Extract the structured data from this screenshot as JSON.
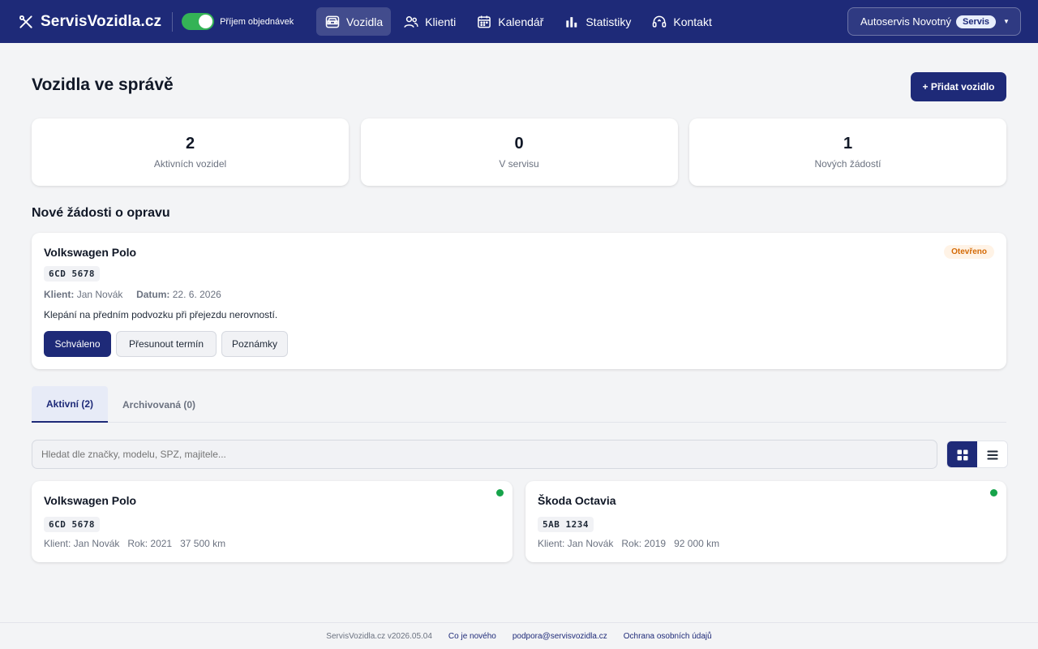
{
  "header": {
    "brand": "ServisVozidla.cz",
    "toggle_label": "Příjem objednávek",
    "toggle_on": true,
    "nav": [
      {
        "label": "Vozidla",
        "icon": "car-icon",
        "active": true
      },
      {
        "label": "Klienti",
        "icon": "users-icon",
        "active": false
      },
      {
        "label": "Kalendář",
        "icon": "calendar-icon",
        "active": false
      },
      {
        "label": "Statistiky",
        "icon": "bar-chart-icon",
        "active": false
      },
      {
        "label": "Kontakt",
        "icon": "headset-icon",
        "active": false
      }
    ],
    "account": {
      "name": "Autoservis Novotný",
      "badge": "Servis"
    }
  },
  "page": {
    "title": "Vozidla ve správě",
    "add_button": "+ Přidat vozidlo"
  },
  "stats": [
    {
      "value": "2",
      "label": "Aktivních vozidel"
    },
    {
      "value": "0",
      "label": "V servisu"
    },
    {
      "value": "1",
      "label": "Nových žádostí"
    }
  ],
  "requests": {
    "title": "Nové žádosti o opravu",
    "items": [
      {
        "vehicle": "Volkswagen Polo",
        "plate": "6CD 5678",
        "client_label": "Klient:",
        "client": "Jan Novák",
        "date_label": "Datum:",
        "date": "22. 6. 2026",
        "description": "Klepání na předním podvozku při přejezdu nerovností.",
        "status": "Otevřeno",
        "actions": {
          "approve": "Schváleno",
          "reschedule": "Přesunout termín",
          "notes": "Poznámky"
        }
      }
    ]
  },
  "tabs": [
    {
      "label": "Aktivní (2)",
      "active": true
    },
    {
      "label": "Archivovaná (0)",
      "active": false
    }
  ],
  "search": {
    "placeholder": "Hledat dle značky, modelu, SPZ, majitele..."
  },
  "view_mode": "grid",
  "vehicles": [
    {
      "name": "Volkswagen Polo",
      "plate": "6CD 5678",
      "client": "Klient: Jan Novák",
      "year": "Rok: 2021",
      "km": "37 500 km",
      "status_color": "#16a34a"
    },
    {
      "name": "Škoda Octavia",
      "plate": "5AB 1234",
      "client": "Klient: Jan Novák",
      "year": "Rok: 2019",
      "km": "92 000 km",
      "status_color": "#16a34a"
    }
  ],
  "footer": {
    "version": "ServisVozidla.cz v2026.05.04",
    "links": [
      "Co je nového",
      "podpora@servisvozidla.cz",
      "Ochrana osobních údajů"
    ]
  },
  "colors": {
    "primary": "#1e2a78",
    "success": "#16a34a",
    "warning": "#d46a06"
  }
}
